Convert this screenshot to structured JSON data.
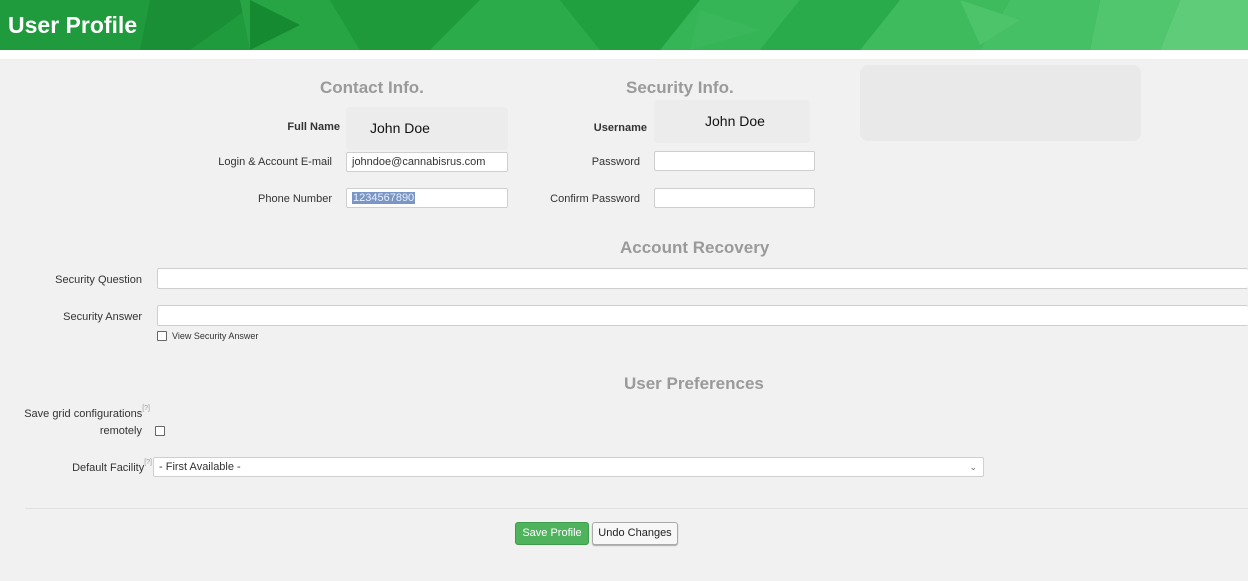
{
  "header": {
    "title": "User Profile"
  },
  "contact": {
    "heading": "Contact Info.",
    "full_name_label": "Full Name",
    "full_name_value": "John Doe",
    "email_label": "Login & Account E-mail",
    "email_value": "johndoe@cannabisrus.com",
    "phone_label": "Phone Number",
    "phone_value": "1234567890"
  },
  "security": {
    "heading": "Security Info.",
    "username_label": "Username",
    "username_value": "John Doe",
    "password_label": "Password",
    "confirm_password_label": "Confirm Password"
  },
  "recovery": {
    "heading": "Account Recovery",
    "question_label": "Security Question",
    "answer_label": "Security Answer",
    "view_answer_label": "View Security Answer"
  },
  "preferences": {
    "heading": "User Preferences",
    "save_grid_label_line1": "Save grid configurations",
    "save_grid_label_line2": "remotely",
    "help_marker": "[?]",
    "default_facility_label": "Default Facility",
    "default_facility_value": "- First Available -"
  },
  "actions": {
    "save_label": "Save Profile",
    "undo_label": "Undo Changes"
  },
  "colors": {
    "brand_green": "#1f9a3c",
    "button_green": "#4eb35c"
  }
}
